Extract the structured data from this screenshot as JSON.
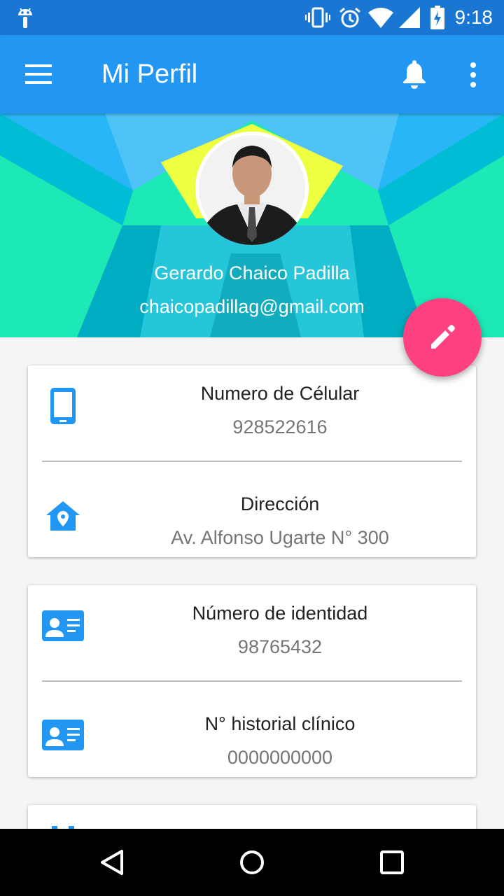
{
  "status_bar": {
    "time": "9:18",
    "icons": [
      "android-icon",
      "vibrate-icon",
      "alarm-icon",
      "wifi-icon",
      "signal-icon",
      "battery-charging-icon"
    ]
  },
  "app_bar": {
    "title": "Mi Perfil",
    "menu_icon": "hamburger-menu-icon",
    "actions": [
      "bell-icon",
      "more-vert-icon"
    ],
    "color": "#2196f3"
  },
  "profile": {
    "name": "Gerardo Chaico Padilla",
    "email": "chaicopadillag@gmail.com",
    "fab_icon": "pencil-icon",
    "fab_color": "#ff4081"
  },
  "cards": [
    {
      "rows": [
        {
          "icon": "smartphone-icon",
          "label": "Numero de Célular",
          "value": "928522616"
        },
        {
          "icon": "home-location-icon",
          "label": "Dirección",
          "value": "Av. Alfonso Ugarte N° 300"
        }
      ]
    },
    {
      "rows": [
        {
          "icon": "id-card-icon",
          "label": "Número de identidad",
          "value": "98765432"
        },
        {
          "icon": "id-card-icon",
          "label": "N° historial clínico",
          "value": "0000000000"
        }
      ]
    }
  ],
  "nav_bar": [
    "back-icon",
    "home-icon",
    "recents-icon"
  ]
}
